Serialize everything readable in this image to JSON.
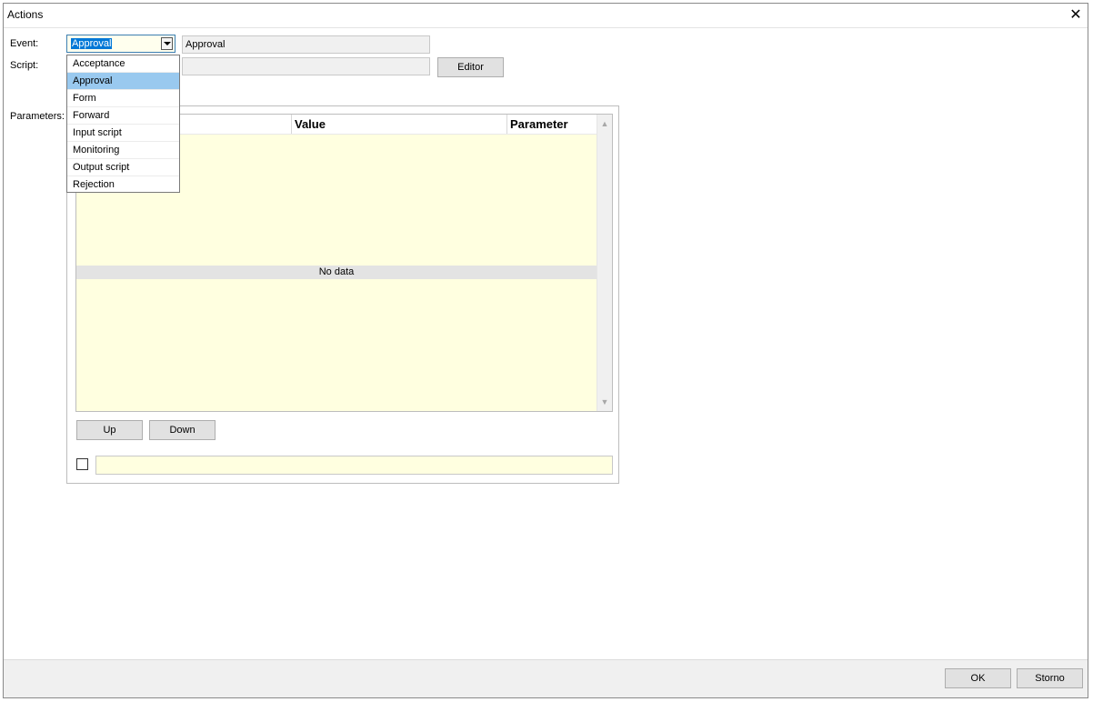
{
  "window": {
    "title": "Actions",
    "close_glyph": "✕"
  },
  "form": {
    "event_label": "Event:",
    "script_label": "Script:",
    "parameters_label": "Parameters:",
    "event_value": "Approval",
    "event_description": "Approval",
    "script_value": "",
    "editor_button": "Editor"
  },
  "dropdown": {
    "items": [
      {
        "label": "Acceptance",
        "selected": false
      },
      {
        "label": "Approval",
        "selected": true
      },
      {
        "label": "Form",
        "selected": false
      },
      {
        "label": "Forward",
        "selected": false
      },
      {
        "label": "Input script",
        "selected": false
      },
      {
        "label": "Monitoring",
        "selected": false
      },
      {
        "label": "Output script",
        "selected": false
      },
      {
        "label": "Rejection",
        "selected": false
      }
    ]
  },
  "grid": {
    "columns": [
      "Value",
      "Parameter"
    ],
    "empty_text": "No data",
    "scroll_up_glyph": "▲",
    "scroll_down_glyph": "▼"
  },
  "buttons": {
    "up": "Up",
    "down": "Down",
    "ok": "OK",
    "storno": "Storno"
  },
  "bottom_field": {
    "checked": false,
    "value": ""
  }
}
